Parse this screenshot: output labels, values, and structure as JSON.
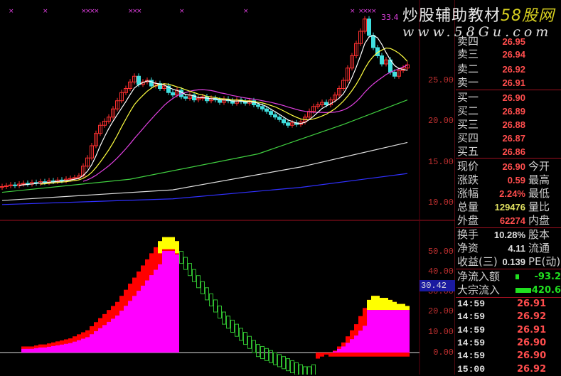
{
  "price_axis": [
    "25.00",
    "20.00",
    "15.00",
    "10.00"
  ],
  "ind_axis": [
    "50.00",
    "40.00",
    "30.00",
    "20.00",
    "10.00",
    "0.00"
  ],
  "cursor_value": "30.42",
  "high_label": "33.4",
  "watermark": {
    "text1": "炒股辅助教材",
    "text2": "58股网",
    "url": "www.58Gu.com"
  },
  "colors": {
    "up": "#ff3030",
    "down": "#40e0e0",
    "ma5": "#ffffff",
    "ma10": "#ffff40",
    "ma20": "#e040e0",
    "ma60": "#40d040",
    "long1": "#e0e0e0",
    "long2": "#3030ff",
    "red": "#ff0000",
    "magenta": "#ff00ff",
    "yellow": "#ffff00",
    "hollow": "#30c030"
  },
  "closes": [
    12.0,
    12.1,
    12.2,
    12.1,
    12.3,
    12.4,
    12.3,
    12.5,
    12.4,
    12.6,
    12.5,
    12.7,
    12.6,
    12.8,
    12.7,
    12.9,
    13.0,
    13.1,
    13.3,
    14.5,
    15.5,
    17.0,
    18.5,
    19.5,
    20.0,
    20.5,
    21.5,
    22.5,
    23.5,
    24.0,
    24.8,
    25.5,
    24.5,
    24.8,
    25.0,
    24.3,
    24.6,
    24.0,
    24.3,
    23.5,
    23.2,
    23.8,
    23.0,
    22.8,
    23.2,
    22.6,
    22.8,
    23.0,
    22.5,
    22.8,
    22.6,
    22.3,
    22.7,
    22.5,
    22.2,
    22.6,
    22.4,
    22.2,
    22.5,
    22.0,
    21.8,
    21.5,
    21.2,
    20.8,
    20.5,
    20.2,
    19.8,
    19.5,
    19.8,
    19.6,
    19.9,
    20.5,
    21.2,
    21.8,
    22.0,
    22.3,
    22.0,
    22.6,
    23.2,
    24.0,
    25.0,
    26.5,
    28.0,
    29.5,
    31.0,
    32.5,
    30.5,
    29.0,
    28.0,
    27.0,
    27.5,
    26.0,
    25.5,
    26.2,
    26.5,
    26.9
  ],
  "long_lines": {
    "ma60": [
      [
        0,
        11.3
      ],
      [
        30,
        12.9
      ],
      [
        60,
        16.0
      ],
      [
        80,
        19.6
      ],
      [
        95,
        22.6
      ]
    ],
    "ma120": [
      [
        0,
        10.3
      ],
      [
        40,
        11.6
      ],
      [
        70,
        14.4
      ],
      [
        95,
        17.4
      ]
    ],
    "ma250": [
      [
        0,
        9.8
      ],
      [
        40,
        10.5
      ],
      [
        70,
        11.9
      ],
      [
        95,
        13.6
      ]
    ]
  },
  "markers": [
    2,
    10,
    19,
    20,
    21,
    22,
    30,
    31,
    32,
    42,
    57,
    82,
    84,
    85,
    86,
    87
  ],
  "indicator": {
    "sec1_start": 5,
    "sec1": [
      3,
      3,
      3,
      3.5,
      4,
      4,
      4.5,
      5,
      5.5,
      6,
      6.5,
      7,
      8,
      9,
      10,
      11,
      13,
      15,
      17,
      19,
      21,
      23,
      25,
      28,
      31,
      34,
      37,
      40,
      43,
      46,
      49,
      52,
      55,
      57,
      57,
      57,
      55
    ],
    "sec2_start": 42,
    "sec2": [
      50,
      47,
      44,
      41,
      38,
      35,
      32,
      29,
      26,
      23,
      20,
      18,
      16,
      14,
      12,
      10,
      8,
      6,
      4,
      3,
      2,
      1,
      0,
      -1,
      -2,
      -3,
      -4,
      -5,
      -6,
      -7,
      -7,
      -6
    ],
    "sec3_start": 74,
    "sec3": [
      -3,
      -2,
      -1,
      0,
      1,
      3,
      5,
      8,
      11,
      14,
      18,
      22,
      26,
      28,
      28,
      27,
      27,
      26,
      25,
      24,
      24,
      23
    ]
  },
  "orderbook": {
    "sell": [
      {
        "label": "卖四",
        "price": "26.95"
      },
      {
        "label": "卖三",
        "price": "26.94"
      },
      {
        "label": "卖二",
        "price": "26.92"
      },
      {
        "label": "卖一",
        "price": "26.91"
      }
    ],
    "buy": [
      {
        "label": "买一",
        "price": "26.90"
      },
      {
        "label": "买二",
        "price": "26.89"
      },
      {
        "label": "买三",
        "price": "26.88"
      },
      {
        "label": "买四",
        "price": "26.87"
      },
      {
        "label": "买五",
        "price": "26.86"
      }
    ]
  },
  "quote": [
    {
      "label": "现价",
      "value": "26.90",
      "right": "今开",
      "color": "#ff4d4d"
    },
    {
      "label": "涨跌",
      "value": "0.59",
      "right": "最高",
      "color": "#ff4d4d"
    },
    {
      "label": "涨幅",
      "value": "2.24%",
      "right": "最低",
      "color": "#ff4d4d"
    },
    {
      "label": "总量",
      "value": "129476",
      "right": "量比",
      "color": "#e0e060"
    },
    {
      "label": "外盘",
      "value": "62274",
      "right": "内盘",
      "color": "#ff4d4d"
    },
    {
      "label": "换手",
      "value": "10.28%",
      "right": "股本",
      "color": "#e0e0e0"
    },
    {
      "label": "净资",
      "value": "4.11",
      "right": "流通",
      "color": "#e0e0e0"
    },
    {
      "label": "收益(三)",
      "value": "0.139",
      "right": "PE(动)",
      "color": "#e0e0e0"
    }
  ],
  "flow": [
    {
      "label": "净流入额",
      "value": "-93.2"
    },
    {
      "label": "大宗流入",
      "value": "-420.6"
    }
  ],
  "ticks": [
    {
      "time": "14:59",
      "price": "26.91"
    },
    {
      "time": "14:59",
      "price": "26.92"
    },
    {
      "time": "14:59",
      "price": "26.91"
    },
    {
      "time": "14:59",
      "price": "26.90"
    },
    {
      "time": "14:59",
      "price": "26.90"
    },
    {
      "time": "15:00",
      "price": "26.92"
    }
  ]
}
